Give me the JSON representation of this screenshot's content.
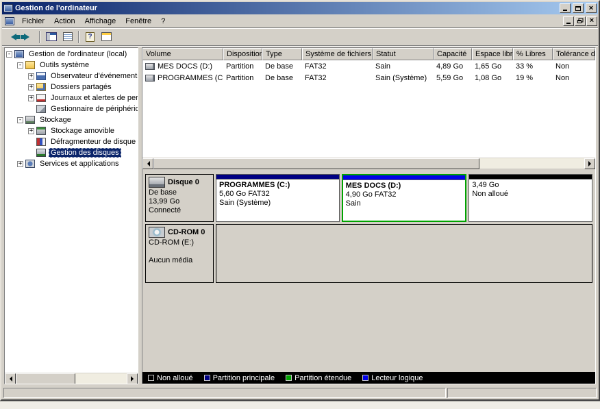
{
  "window": {
    "title": "Gestion de l'ordinateur",
    "control_icons": [
      "minimize-icon",
      "maximize-icon",
      "close-icon"
    ],
    "mdi_control_icons": [
      "minimize-icon",
      "restore-icon",
      "close-icon"
    ]
  },
  "menu": {
    "items": [
      "Fichier",
      "Action",
      "Affichage",
      "Fenêtre",
      "?"
    ]
  },
  "toolbar": {
    "button_icons": [
      "back-arrow",
      "forward-arrow",
      "show-console-tree",
      "properties-list",
      "help-book",
      "export-list"
    ]
  },
  "tree": {
    "items": [
      {
        "label": "Gestion de l'ordinateur (local)",
        "sign": "-"
      },
      {
        "label": "Outils système",
        "sign": "-"
      },
      {
        "label": "Observateur d'événements",
        "sign": "+"
      },
      {
        "label": "Dossiers partagés",
        "sign": "+"
      },
      {
        "label": "Journaux et alertes de perfo",
        "sign": "+"
      },
      {
        "label": "Gestionnaire de périphérique",
        "sign": ""
      },
      {
        "label": "Stockage",
        "sign": "-"
      },
      {
        "label": "Stockage amovible",
        "sign": "+"
      },
      {
        "label": "Défragmenteur de disque",
        "sign": ""
      },
      {
        "label": "Gestion des disques",
        "sign": ""
      },
      {
        "label": "Services et applications",
        "sign": "+"
      }
    ]
  },
  "volume_list": {
    "columns": [
      "Volume",
      "Disposition",
      "Type",
      "Système de fichiers",
      "Statut",
      "Capacité",
      "Espace libre",
      "% Libres",
      "Tolérance d..."
    ],
    "rows": [
      {
        "volume": "MES DOCS (D:)",
        "disposition": "Partition",
        "type": "De base",
        "fs": "FAT32",
        "statut": "Sain",
        "capacite": "4,89 Go",
        "libre": "1,65 Go",
        "pct": "33 %",
        "tol": "Non"
      },
      {
        "volume": "PROGRAMMES (C:)",
        "disposition": "Partition",
        "type": "De base",
        "fs": "FAT32",
        "statut": "Sain (Système)",
        "capacite": "5,59 Go",
        "libre": "1,08 Go",
        "pct": "19 %",
        "tol": "Non"
      }
    ]
  },
  "disk0": {
    "name": "Disque 0",
    "type": "De base",
    "size": "13,99 Go",
    "status": "Connecté",
    "partitions": [
      {
        "line1": "PROGRAMMES (C:)",
        "line2": "5,60 Go FAT32",
        "line3": "Sain (Système)",
        "stripe": "#000082"
      },
      {
        "line1": "MES DOCS  (D:)",
        "line2": "4,90 Go FAT32",
        "line3": "Sain",
        "stripe": "#0000e8",
        "border": "#00a300"
      },
      {
        "line1": "3,49 Go",
        "line2": "Non alloué",
        "line3": "",
        "stripe": "#000000"
      }
    ]
  },
  "cdrom": {
    "name": "CD-ROM 0",
    "type": "CD-ROM (E:)",
    "status": "Aucun média"
  },
  "legend": {
    "items": [
      {
        "label": "Non alloué",
        "color": "#000000"
      },
      {
        "label": "Partition principale",
        "color": "#000082"
      },
      {
        "label": "Partition étendue",
        "color": "#00a300"
      },
      {
        "label": "Lecteur logique",
        "color": "#0000e8"
      }
    ]
  }
}
